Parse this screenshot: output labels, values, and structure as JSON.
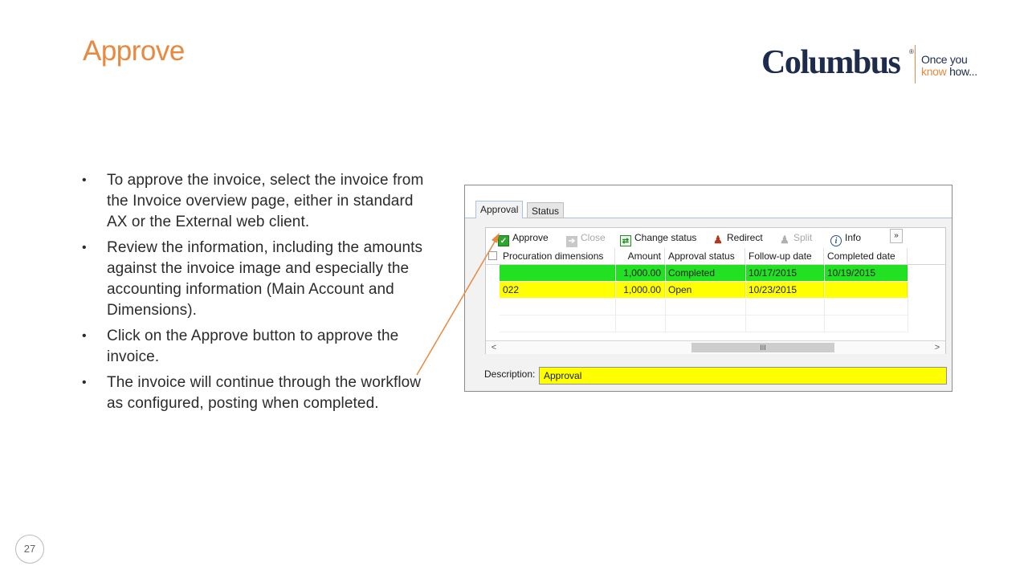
{
  "slide": {
    "title": "Approve",
    "page_number": "27",
    "accent_color": "#e8893f"
  },
  "logo": {
    "name": "Columbus",
    "reg_mark": "®",
    "tagline_line1": "Once you",
    "tagline_know": "know",
    "tagline_rest": " how..."
  },
  "bullets": [
    "To approve the invoice, select the invoice from the Invoice overview page, either in standard AX or the External web client.",
    "Review the information, including the amounts against the invoice image and especially the accounting information (Main Account and Dimensions).",
    "Click on the Approve button to approve the invoice.",
    "The invoice will continue through the workflow as configured, posting when completed."
  ],
  "ax_panel": {
    "tabs": [
      "Approval",
      "Status"
    ],
    "active_tab": "Approval",
    "toolbar": {
      "approve": "Approve",
      "close": "Close",
      "change_status": "Change status",
      "redirect": "Redirect",
      "split": "Split",
      "info": "Info",
      "more": "»"
    },
    "columns": [
      "Procuration dimensions",
      "Amount",
      "Approval status",
      "Follow-up date",
      "Completed date"
    ],
    "rows": [
      {
        "dimensions": "",
        "amount": "1,000.00",
        "status": "Completed",
        "followup": "10/17/2015",
        "completed": "10/19/2015",
        "color": "#22e022"
      },
      {
        "dimensions": "022",
        "amount": "1,000.00",
        "status": "Open",
        "followup": "10/23/2015",
        "completed": "",
        "color": "#ffff00"
      }
    ],
    "scroll_thumb": "III",
    "scroll_left": "<",
    "scroll_right": ">",
    "description_label": "Description:",
    "description_value": "Approval",
    "description_color": "#ffff00"
  }
}
